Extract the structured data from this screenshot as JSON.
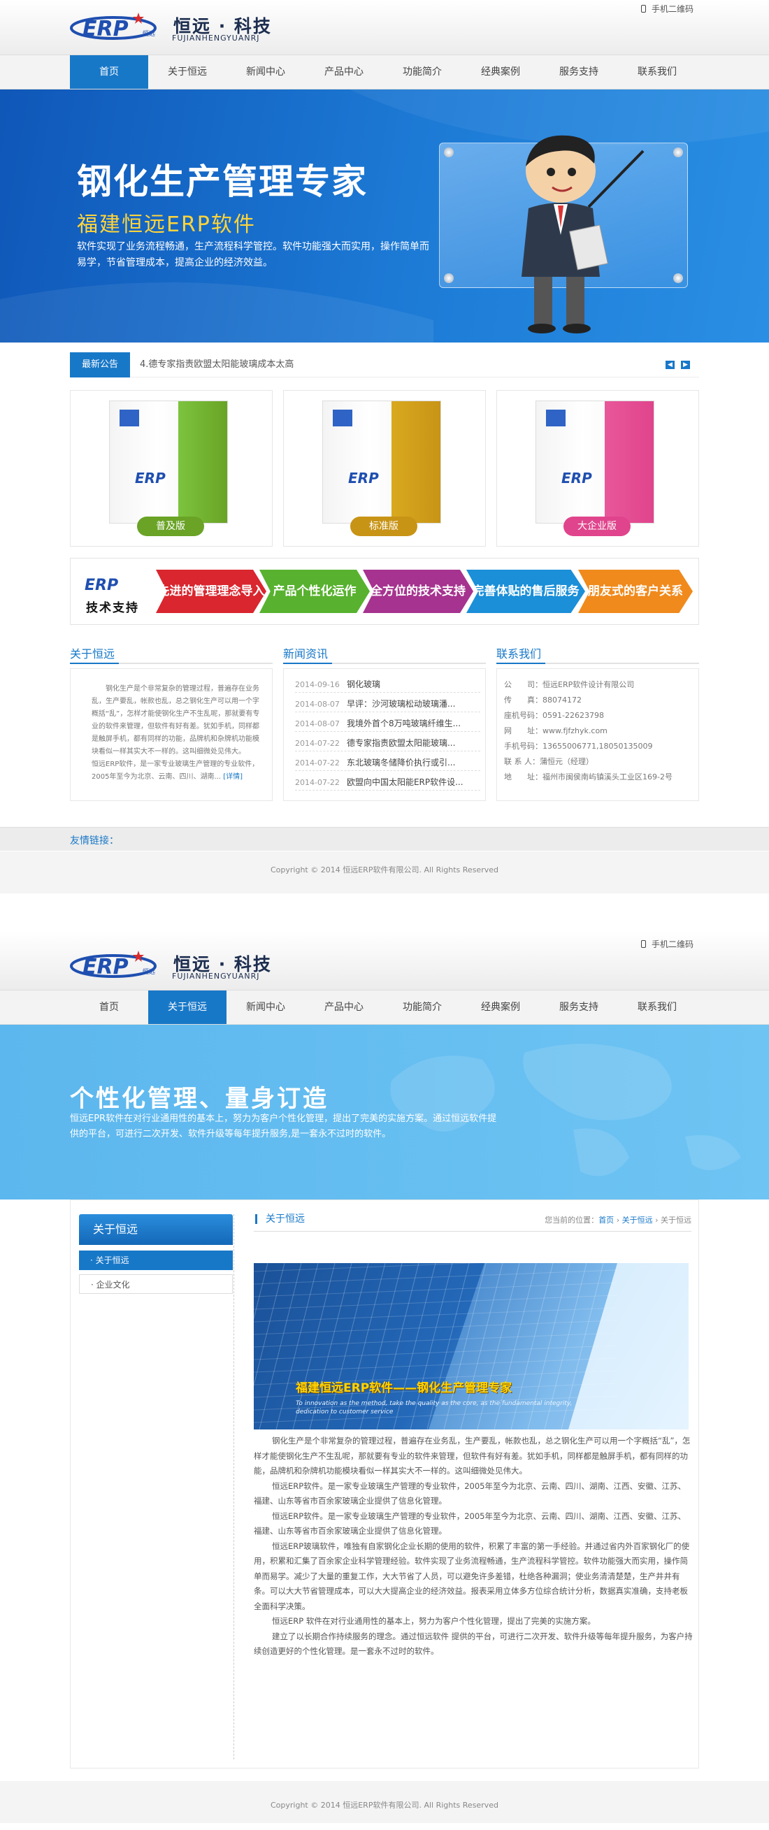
{
  "header": {
    "logo_mark": "ERP",
    "logo_small": "恒远",
    "brand_cn": "恒远 · 科技",
    "brand_en": "FUJIANHENGYUANRJ",
    "qrcode_label": "手机二维码"
  },
  "nav": [
    "首页",
    "关于恒远",
    "新闻中心",
    "产品中心",
    "功能简介",
    "经典案例",
    "服务支持",
    "联系我们"
  ],
  "home": {
    "banner": {
      "title": "钢化生产管理专家",
      "subtitle": "福建恒远ERP软件",
      "desc": "软件实现了业务流程畅通，生产流程科学管控。软件功能强大而实用，操作简单而易学，节省管理成本，提高企业的经济效益。"
    },
    "notice": {
      "tag": "最新公告",
      "text": "4.德专家指责欧盟太阳能玻璃成本太高"
    },
    "products": [
      {
        "label": "普及版",
        "color": "#7cc43e",
        "btn": "#6aa326"
      },
      {
        "label": "标准版",
        "color": "#d9a91f",
        "btn": "#c89416"
      },
      {
        "label": "大企业版",
        "color": "#e9579a",
        "btn": "#e0448c"
      }
    ],
    "box_logo": "ERP",
    "tech": {
      "logo": "ERP",
      "label": "技术支持",
      "items": [
        {
          "text": "先进的管理理念导入",
          "color": "#d9262f"
        },
        {
          "text": "产品个性化运作",
          "color": "#58b22f"
        },
        {
          "text": "全方位的技术支持",
          "color": "#a6338f"
        },
        {
          "text": "完善体贴的售后服务",
          "color": "#1b8fd8"
        },
        {
          "text": "朋友式的客户关系",
          "color": "#f08a1c"
        }
      ]
    },
    "about": {
      "title": "关于恒远",
      "p1": "钢化生产是个非常复杂的管理过程，普遍存在业务乱，生产要乱，帐款也乱，总之钢化生产可以用一个字概括“乱”，怎样才能使钢化生产不生乱呢，那就要有专业的软件来管理，但软件有好有差。犹如手机，同样都是触屏手机，都有同样的功能，品牌机和杂牌机功能模块看似一样其实大不一样的。这叫细微处见伟大。",
      "p2": "恒远ERP软件，是一家专业玻璃生产管理的专业软件，2005年至今为北京、云南、四川、湖南...",
      "more": "[详情]"
    },
    "news": {
      "title": "新闻资讯",
      "items": [
        {
          "date": "2014-09-16",
          "title": "钢化玻璃"
        },
        {
          "date": "2014-08-07",
          "title": "早评：沙河玻璃松动玻璃潘..."
        },
        {
          "date": "2014-08-07",
          "title": "我境外首个8万吨玻璃纤维生..."
        },
        {
          "date": "2014-07-22",
          "title": "德专家指责欧盟太阳能玻璃..."
        },
        {
          "date": "2014-07-22",
          "title": "东北玻璃冬储降价执行或引..."
        },
        {
          "date": "2014-07-22",
          "title": "欧盟向中国太阳能ERP软件设..."
        }
      ]
    },
    "contact": {
      "title": "联系我们",
      "rows": [
        "公　　司：恒远ERP软件设计有限公司",
        "传　　真：88074172",
        "座机号码：0591-22623798",
        "网　　址：www.fjfzhyk.com",
        "手机号码：13655006771,18050135009",
        "联 系 人：蒲恒元（经理）",
        "地　　址：福州市闽侯南屿镇溪头工业区169-2号"
      ]
    },
    "friend_links": "友情链接：",
    "copyright": "Copyright © 2014 恒远ERP软件有限公司. All Rights Reserved"
  },
  "about_page": {
    "banner": {
      "title": "个性化管理、量身订造",
      "desc": "恒远EPR软件在对行业通用性的基本上，努力为客户个性化管理，提出了完美的实施方案。通过恒远软件提供的平台，可进行二次开发、软件升级等每年提升服务,是一套永不过时的软件。"
    },
    "sidebar": {
      "title": "关于恒远",
      "items": [
        "· 关于恒远",
        "· 企业文化"
      ]
    },
    "section_title": "关于恒远",
    "breadcrumb": {
      "prefix": "您当前的位置：",
      "home": "首页",
      "parent": "关于恒远",
      "current": "关于恒远"
    },
    "image_caption": "福建恒远ERP软件——钢化生产管理专家",
    "image_slogan_1": "To innovation as the method, take the quality as the core, as the fundamental integrity,",
    "image_slogan_2": "dedication to customer service",
    "paragraphs": [
      "钢化生产是个非常复杂的管理过程，普遍存在业务乱，生产要乱，帐款也乱，总之钢化生产可以用一个字概括“乱”，怎样才能使钢化生产不生乱呢，那就要有专业的软件来管理，但软件有好有差。犹如手机，同样都是触屏手机，都有同样的功能，品牌机和杂牌机功能模块看似一样其实大不一样的。这叫细微处见伟大。",
      "恒远ERP软件。是一家专业玻璃生产管理的专业软件，2005年至今为北京、云南、四川、湖南、江西、安徽、江苏、福建、山东等省市百余家玻璃企业提供了信息化管理。",
      "恒远ERP软件。是一家专业玻璃生产管理的专业软件，2005年至今为北京、云南、四川、湖南、江西、安徽、江苏、福建、山东等省市百余家玻璃企业提供了信息化管理。",
      "恒远ERP玻璃软件，唯独有自家钢化企业长期的使用的软件，积累了丰富的第一手经验。并通过省内外百家钢化厂的使用，积累和汇集了百余家企业科学管理经验。软件实现了业务流程畅通，生产流程科学管控。软件功能强大而实用，操作简单而易学。减少了大量的重复工作，大大节省了人员，可以避免许多差错，杜绝各种漏洞；使业务清清楚楚，生产井井有条。可以大大节省管理成本，可以大大提高企业的经济效益。报表采用立体多方位综合统计分析，数据真实准确，支持老板全面科学决策。",
      "恒远ERP 软件在对行业通用性的基本上，努力为客户个性化管理，提出了完美的实施方案。",
      "建立了以长期合作持续服务的理念。通过恒远软件 提供的平台，可进行二次开发、软件升级等每年提升服务，为客户持续创造更好的个性化管理。是一套永不过时的软件。"
    ],
    "copyright": "Copyright © 2014 恒远ERP软件有限公司. All Rights Reserved"
  }
}
